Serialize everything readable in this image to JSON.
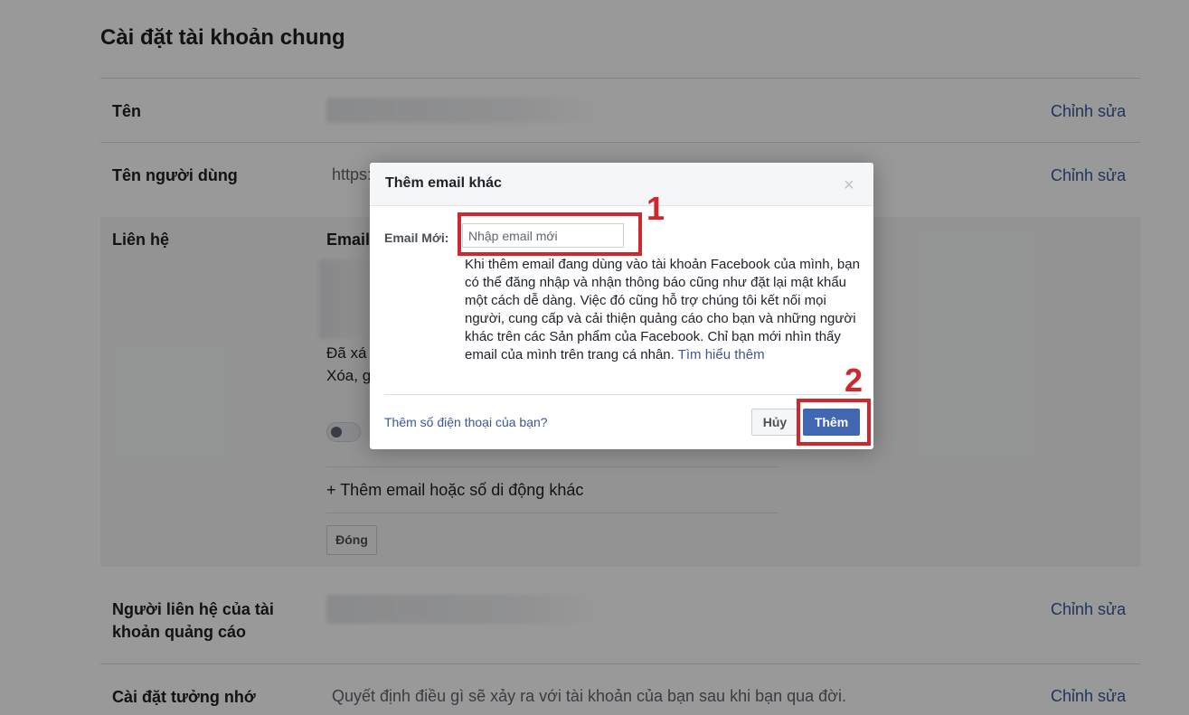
{
  "page": {
    "title": "Cài đặt tài khoản chung",
    "edit_label": "Chỉnh sửa",
    "rows": {
      "name": {
        "label": "Tên"
      },
      "username": {
        "label": "Tên người dùng",
        "value_prefix": "https:"
      },
      "contact": {
        "label": "Liên hệ",
        "email_header": "Email",
        "note_line1": "Đã xá",
        "note_line2": "Xóa, g",
        "add_contact": "+ Thêm email hoặc số di động khác",
        "close_button": "Đóng"
      },
      "ad_contact": {
        "label_line1": "Người liên hệ của tài",
        "label_line2": "khoản quảng cáo"
      },
      "memorial": {
        "label": "Cài đặt tưởng nhớ",
        "description": "Quyết định điều gì sẽ xảy ra với tài khoản của bạn sau khi bạn qua đời."
      }
    }
  },
  "dialog": {
    "title": "Thêm email khác",
    "close_glyph": "×",
    "email_label": "Email Mới:",
    "email_placeholder": "Nhập email mới",
    "email_value": "",
    "info_text": "Khi thêm email đang dùng vào tài khoản Facebook của mình, bạn có thể đăng nhập và nhận thông báo cũng như đặt lại mật khẩu một cách dễ dàng. Việc đó cũng hỗ trợ chúng tôi kết nối mọi người, cung cấp và cải thiện quảng cáo cho bạn và những người khác trên các Sản phẩm của Facebook. Chỉ bạn mới nhìn thấy email của mình trên trang cá nhân.",
    "learn_more": "Tìm hiểu thêm",
    "phone_link": "Thêm số điện thoại của bạn?",
    "cancel_label": "Hủy",
    "add_label": "Thêm"
  },
  "annotations": {
    "step1": "1",
    "step2": "2",
    "highlight_color": "#d0272e"
  },
  "colors": {
    "link": "#385898",
    "primary_button": "#4267b2"
  }
}
